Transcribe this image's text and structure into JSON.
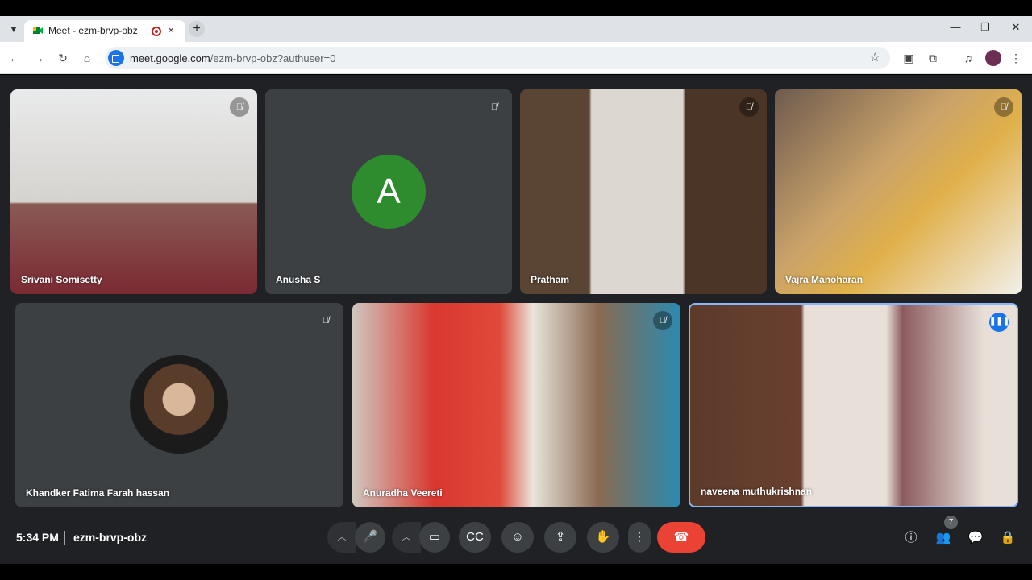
{
  "browser": {
    "tab_title": "Meet - ezm-brvp-obz",
    "tab_close": "×",
    "new_tab": "+",
    "url_host": "meet.google.com",
    "url_path": "/ezm-brvp-obz?authuser=0"
  },
  "participants": [
    {
      "name": "Srivani Somisetty",
      "muted": true
    },
    {
      "name": "Anusha S",
      "initial": "A",
      "muted": true
    },
    {
      "name": "Pratham",
      "muted": true
    },
    {
      "name": "Vajra Manoharan",
      "muted": true
    },
    {
      "name": "Khandker Fatima Farah hassan",
      "muted": true
    },
    {
      "name": "Anuradha Veereti",
      "muted": true
    },
    {
      "name": "naveena muthukrishnan",
      "speaking": true
    }
  ],
  "footer": {
    "time": "5:34 PM",
    "meeting_code": "ezm-brvp-obz",
    "participant_count": "7"
  },
  "colors": {
    "stage_bg": "#202124",
    "tile_bg": "#3c4043",
    "end_call": "#ea4335",
    "active_speaker": "#1a73e8",
    "avatar_green": "#2e8b2e"
  }
}
